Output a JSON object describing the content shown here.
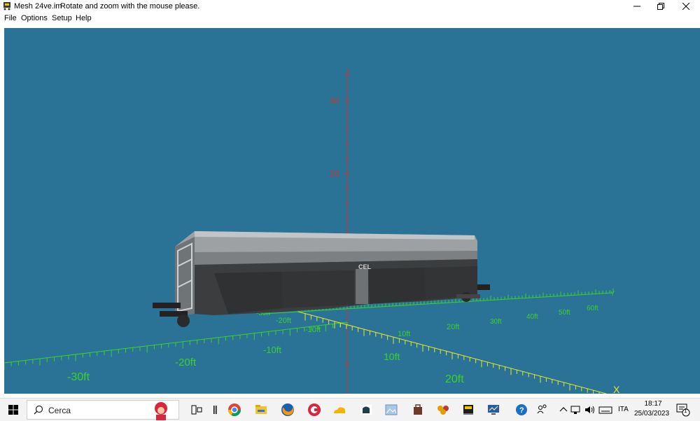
{
  "window": {
    "file_name": "Mesh 24ve.im",
    "hint": "Rotate and zoom with the mouse please."
  },
  "menu": [
    "File",
    "Options",
    "Setup",
    "Help"
  ],
  "viewport": {
    "background": "#2a7397",
    "z_axis": {
      "label": "Z",
      "ticks": [
        "30",
        "20"
      ],
      "color": "#c0392b"
    },
    "y_axis": {
      "label": "Y",
      "ticks": [
        "-30ft",
        "-20ft",
        "-10ft",
        "10ft",
        "20ft",
        "30ft",
        "40ft",
        "50ft",
        "60ft"
      ],
      "color": "#3cd12a"
    },
    "green_axis": {
      "ticks": [
        "-30ft",
        "-20ft",
        "-10ft",
        "10ft",
        "20ft"
      ],
      "color": "#3cd12a"
    },
    "x_axis": {
      "label": "X",
      "ticks": [
        "10ft",
        "20ft"
      ],
      "color": "#e6e62a"
    },
    "model": "freight-wagon-hopper",
    "wagon_lettering": "CEL"
  },
  "taskbar": {
    "search_placeholder": "Cerca",
    "language": "ITA",
    "time": "18:17",
    "date": "25/03/2023",
    "notification_count": "1",
    "icons": [
      "dante-avatar-icon",
      "task-view-icon",
      "pause-icon",
      "chrome-icon",
      "file-explorer-icon",
      "firefox-icon",
      "ccleaner-icon",
      "onedrive-icon",
      "locomotive-icon",
      "image-icon",
      "bag-icon",
      "cards-icon",
      "train-icon",
      "monitor-app-icon",
      "help-icon",
      "people-icon",
      "chevron-up-icon",
      "network-icon",
      "volume-icon",
      "keyboard-icon"
    ]
  }
}
